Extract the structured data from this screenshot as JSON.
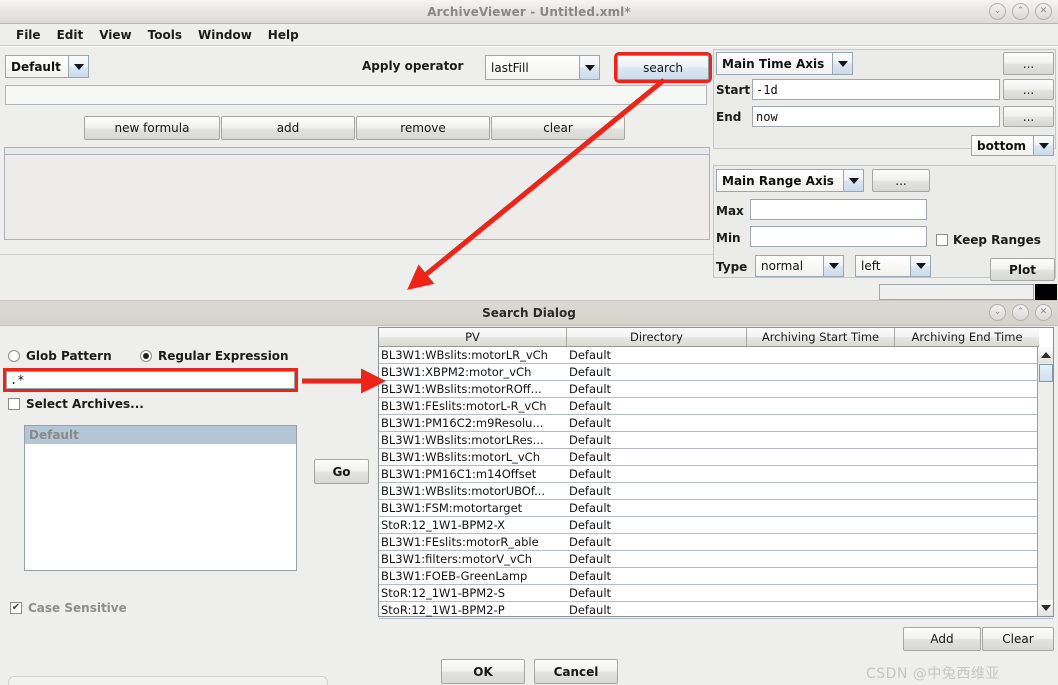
{
  "window": {
    "title": "ArchiveViewer - Untitled.xml*",
    "buttons": {
      "minimize": "⌄",
      "maximize": "⌃",
      "close": "✕"
    }
  },
  "menubar": {
    "items": [
      "File",
      "Edit",
      "View",
      "Tools",
      "Window",
      "Help"
    ]
  },
  "toolbar": {
    "profile_value": "Default",
    "apply_operator_label": "Apply operator",
    "operator_value": "lastFill",
    "search_label": "search",
    "formula_value": "",
    "new_formula_label": "new formula",
    "add_label": "add",
    "remove_label": "remove",
    "clear_label": "clear",
    "highlight_color": "#ef2419"
  },
  "time_axis": {
    "axis_value": "Main Time Axis",
    "ellipsis_label": "...",
    "start_label": "Start",
    "start_value": "-1d",
    "start_ellipsis": "...",
    "end_label": "End",
    "end_value": "now",
    "end_ellipsis": "...",
    "position_value": "bottom"
  },
  "range_axis": {
    "axis_value": "Main Range Axis",
    "ellipsis_label": "...",
    "max_label": "Max",
    "max_value": "",
    "min_label": "Min",
    "min_value": "",
    "type_label": "Type",
    "type_value": "normal",
    "side_value": "left",
    "keep_ranges_label": "Keep Ranges",
    "keep_ranges_checked": false,
    "plot_label": "Plot",
    "status_value": ""
  },
  "search_dialog": {
    "title": "Search Dialog",
    "buttons": {
      "minimize": "⌄",
      "maximize": "⌃",
      "close": "✕"
    },
    "glob_pattern_label": "Glob Pattern",
    "glob_pattern_selected": false,
    "regular_expression_label": "Regular Expression",
    "regular_expression_selected": true,
    "pattern_value": ".*",
    "select_archives_label": "Select Archives...",
    "select_archives_checked": false,
    "archives": [
      "Default"
    ],
    "go_label": "Go",
    "case_sensitive_label": "Case Sensitive",
    "case_sensitive_checked": true,
    "add_label": "Add",
    "clear_label": "Clear",
    "ok_label": "OK",
    "cancel_label": "Cancel",
    "table": {
      "columns": [
        "PV",
        "Directory",
        "Archiving Start Time",
        "Archiving End Time"
      ],
      "rows": [
        {
          "pv": "BL3W1:WBslits:motorLR_vCh",
          "dir": "Default",
          "start": "",
          "end": ""
        },
        {
          "pv": "BL3W1:XBPM2:motor_vCh",
          "dir": "Default",
          "start": "",
          "end": ""
        },
        {
          "pv": "BL3W1:WBslits:motorROff...",
          "dir": "Default",
          "start": "",
          "end": ""
        },
        {
          "pv": "BL3W1:FEslits:motorL-R_vCh",
          "dir": "Default",
          "start": "",
          "end": ""
        },
        {
          "pv": "BL3W1:PM16C2:m9Resolu...",
          "dir": "Default",
          "start": "",
          "end": ""
        },
        {
          "pv": "BL3W1:WBslits:motorLRes...",
          "dir": "Default",
          "start": "",
          "end": ""
        },
        {
          "pv": "BL3W1:WBslits:motorL_vCh",
          "dir": "Default",
          "start": "",
          "end": ""
        },
        {
          "pv": "BL3W1:PM16C1:m14Offset",
          "dir": "Default",
          "start": "",
          "end": ""
        },
        {
          "pv": "BL3W1:WBslits:motorUBOf...",
          "dir": "Default",
          "start": "",
          "end": ""
        },
        {
          "pv": "BL3W1:FSM:motortarget",
          "dir": "Default",
          "start": "",
          "end": ""
        },
        {
          "pv": "StoR:12_1W1-BPM2-X",
          "dir": "Default",
          "start": "",
          "end": ""
        },
        {
          "pv": "BL3W1:FEslits:motorR_able",
          "dir": "Default",
          "start": "",
          "end": ""
        },
        {
          "pv": "BL3W1:filters:motorV_vCh",
          "dir": "Default",
          "start": "",
          "end": ""
        },
        {
          "pv": "BL3W1:FOEB-GreenLamp",
          "dir": "Default",
          "start": "",
          "end": ""
        },
        {
          "pv": "StoR:12_1W1-BPM2-S",
          "dir": "Default",
          "start": "",
          "end": ""
        },
        {
          "pv": "StoR:12_1W1-BPM2-P",
          "dir": "Default",
          "start": "",
          "end": ""
        }
      ]
    }
  },
  "watermark": {
    "text": "CSDN @中兔西维亚"
  }
}
